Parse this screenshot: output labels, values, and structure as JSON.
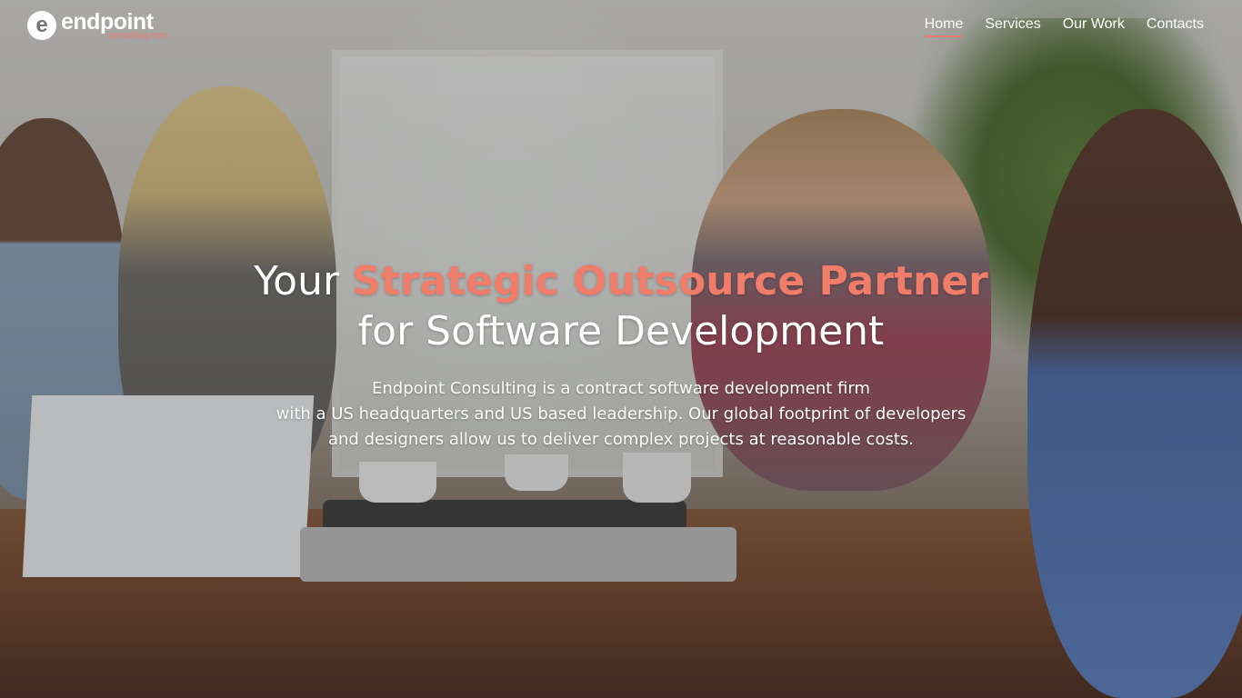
{
  "brand": {
    "logo_mark": "e",
    "name": "endpoint",
    "tagline": "consulting.com",
    "accent_color": "#f07c6a"
  },
  "nav": {
    "items": [
      {
        "label": "Home",
        "active": true
      },
      {
        "label": "Services",
        "active": false
      },
      {
        "label": "Our Work",
        "active": false
      },
      {
        "label": "Contacts",
        "active": false
      }
    ]
  },
  "hero": {
    "headline_prefix": "Your",
    "headline_accent": "Strategic Outsource Partner",
    "headline_line2": "for Software Development",
    "description_lines": [
      "Endpoint Consulting is a contract software development firm",
      "with a US headquarters and US based leadership. Our global footprint of developers",
      "and designers allow us to deliver complex projects at reasonable costs."
    ]
  }
}
